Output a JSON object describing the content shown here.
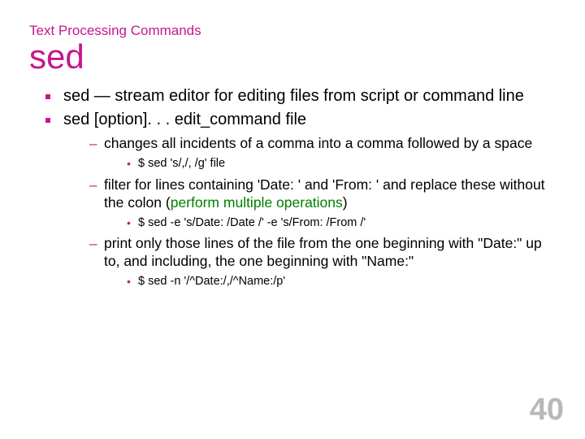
{
  "section_heading": "Text Processing Commands",
  "title": "sed",
  "bullets": {
    "l1": {
      "b0": "sed — stream editor for editing files from script or command line",
      "b1": "sed [option]. . . edit_command file"
    },
    "l2": {
      "c0": "changes all incidents of a comma into a comma followed by a space",
      "c1a": "filter for lines containing 'Date: ' and 'From: ' and replace these without the colon (",
      "c1b": "perform  multiple operations",
      "c1c": ")",
      "c2": "print only those lines of the file from the one beginning with \"Date:\" up to, and including, the one beginning with \"Name:\""
    },
    "l3": {
      "e0": "$ sed 's/,/, /g' file",
      "e1": "$ sed -e 's/Date: /Date /' -e 's/From: /From /'",
      "e2": "$ sed -n '/^Date:/,/^Name:/p'"
    }
  },
  "page_number": "40"
}
